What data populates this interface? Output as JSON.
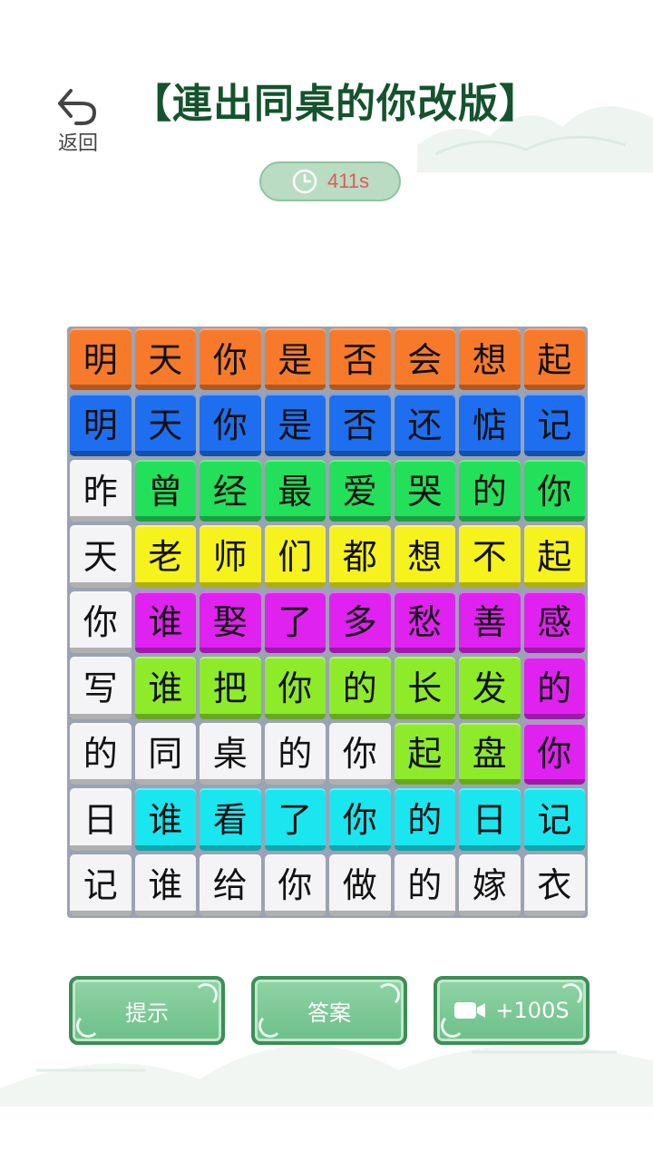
{
  "header": {
    "back_label": "返回",
    "title": "【連出同桌的你改版】"
  },
  "timer": {
    "value": "411s"
  },
  "board": {
    "rows": [
      [
        [
          "明",
          "orange"
        ],
        [
          "天",
          "orange"
        ],
        [
          "你",
          "orange"
        ],
        [
          "是",
          "orange"
        ],
        [
          "否",
          "orange"
        ],
        [
          "会",
          "orange"
        ],
        [
          "想",
          "orange"
        ],
        [
          "起",
          "orange"
        ]
      ],
      [
        [
          "明",
          "blue"
        ],
        [
          "天",
          "blue"
        ],
        [
          "你",
          "blue"
        ],
        [
          "是",
          "blue"
        ],
        [
          "否",
          "blue"
        ],
        [
          "还",
          "blue"
        ],
        [
          "惦",
          "blue"
        ],
        [
          "记",
          "blue"
        ]
      ],
      [
        [
          "昨",
          "white"
        ],
        [
          "曾",
          "green"
        ],
        [
          "经",
          "green"
        ],
        [
          "最",
          "green"
        ],
        [
          "爱",
          "green"
        ],
        [
          "哭",
          "green"
        ],
        [
          "的",
          "green"
        ],
        [
          "你",
          "green"
        ]
      ],
      [
        [
          "天",
          "white"
        ],
        [
          "老",
          "yellow"
        ],
        [
          "师",
          "yellow"
        ],
        [
          "们",
          "yellow"
        ],
        [
          "都",
          "yellow"
        ],
        [
          "想",
          "yellow"
        ],
        [
          "不",
          "yellow"
        ],
        [
          "起",
          "yellow"
        ]
      ],
      [
        [
          "你",
          "white"
        ],
        [
          "谁",
          "magenta"
        ],
        [
          "娶",
          "magenta"
        ],
        [
          "了",
          "magenta"
        ],
        [
          "多",
          "magenta"
        ],
        [
          "愁",
          "magenta"
        ],
        [
          "善",
          "magenta"
        ],
        [
          "感",
          "magenta"
        ]
      ],
      [
        [
          "写",
          "white"
        ],
        [
          "谁",
          "lime"
        ],
        [
          "把",
          "lime"
        ],
        [
          "你",
          "lime"
        ],
        [
          "的",
          "lime"
        ],
        [
          "长",
          "lime"
        ],
        [
          "发",
          "lime"
        ],
        [
          "的",
          "magenta"
        ]
      ],
      [
        [
          "的",
          "white"
        ],
        [
          "同",
          "white"
        ],
        [
          "桌",
          "white"
        ],
        [
          "的",
          "white"
        ],
        [
          "你",
          "white"
        ],
        [
          "起",
          "lime"
        ],
        [
          "盘",
          "lime"
        ],
        [
          "你",
          "magenta"
        ]
      ],
      [
        [
          "日",
          "white"
        ],
        [
          "谁",
          "cyan"
        ],
        [
          "看",
          "cyan"
        ],
        [
          "了",
          "cyan"
        ],
        [
          "你",
          "cyan"
        ],
        [
          "的",
          "cyan"
        ],
        [
          "日",
          "cyan"
        ],
        [
          "记",
          "cyan"
        ]
      ],
      [
        [
          "记",
          "white"
        ],
        [
          "谁",
          "white"
        ],
        [
          "给",
          "white"
        ],
        [
          "你",
          "white"
        ],
        [
          "做",
          "white"
        ],
        [
          "的",
          "white"
        ],
        [
          "嫁",
          "white"
        ],
        [
          "衣",
          "white"
        ]
      ]
    ]
  },
  "colors": {
    "orange": "#f77a2b",
    "blue": "#1e6ff0",
    "green": "#22e05a",
    "yellow": "#f6f21c",
    "magenta": "#e022f0",
    "lime": "#8eeb2a",
    "cyan": "#1ae6f0",
    "white": "#f4f4f6"
  },
  "buttons": {
    "hint_label": "提示",
    "answer_label": "答案",
    "video_label": "+100S"
  }
}
